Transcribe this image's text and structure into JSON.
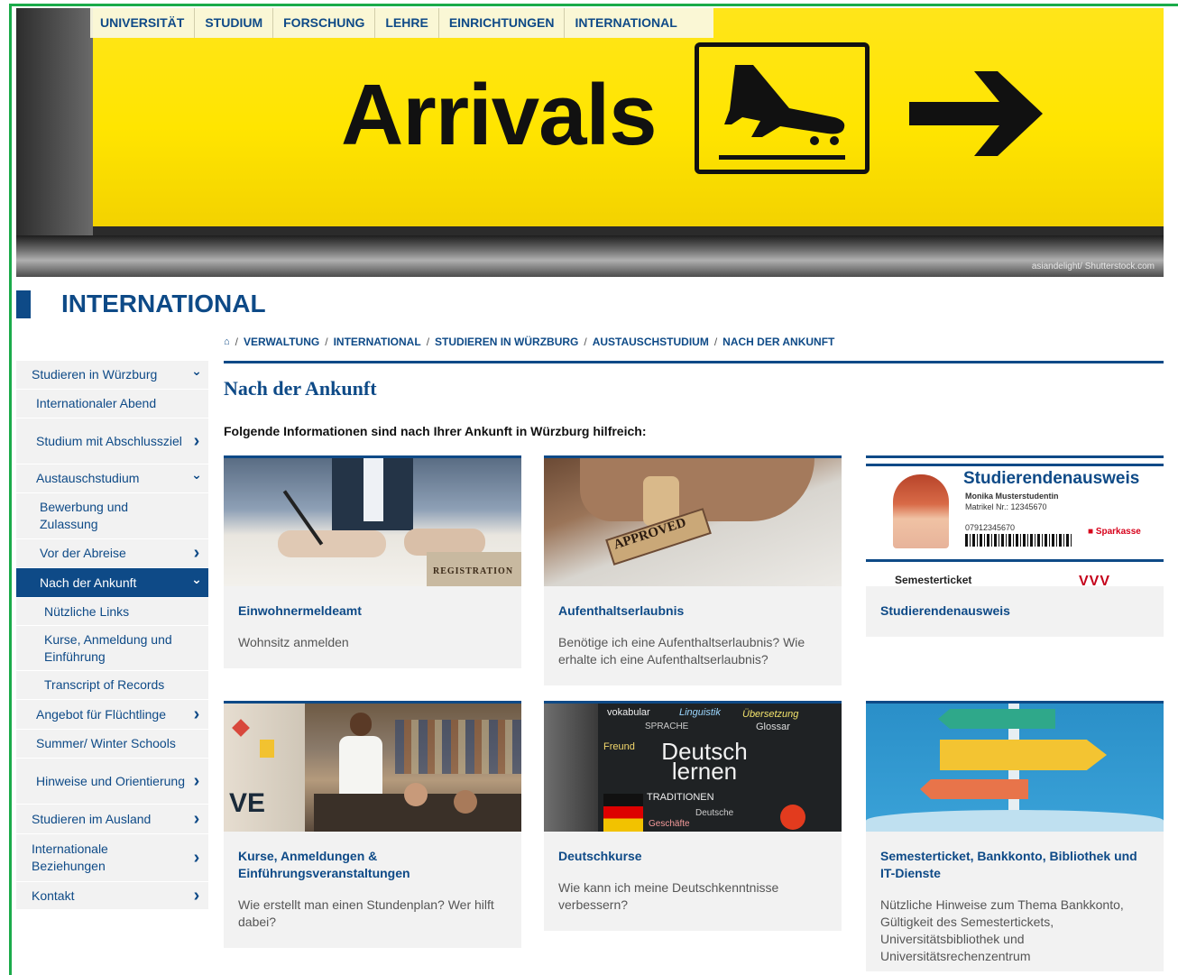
{
  "topnav": [
    "UNIVERSITÄT",
    "STUDIUM",
    "FORSCHUNG",
    "LEHRE",
    "EINRICHTUNGEN",
    "INTERNATIONAL"
  ],
  "hero": {
    "sign_text": "Arrivals",
    "credit": "asiandelight/ Shutterstock.com"
  },
  "section_title": "INTERNATIONAL",
  "breadcrumb": [
    "VERWALTUNG",
    "INTERNATIONAL",
    "STUDIEREN IN WÜRZBURG",
    "AUSTAUSCHSTUDIUM",
    "NACH DER ANKUNFT"
  ],
  "sidebar": [
    {
      "label": "Studieren in Würzburg",
      "level": 0,
      "chevron": "down"
    },
    {
      "label": "Internationaler Abend",
      "level": 1,
      "chevron": ""
    },
    {
      "label": "Studium mit Abschlussziel",
      "level": 1,
      "chevron": "right"
    },
    {
      "label": "Austauschstudium",
      "level": 1,
      "chevron": "down"
    },
    {
      "label": "Bewerbung und Zulassung",
      "level": 2,
      "chevron": ""
    },
    {
      "label": "Vor der Abreise",
      "level": 2,
      "chevron": "right"
    },
    {
      "label": "Nach der Ankunft",
      "level": 2,
      "chevron": "down",
      "active": true
    },
    {
      "label": "Nützliche Links",
      "level": 3,
      "chevron": ""
    },
    {
      "label": "Kurse, Anmeldung und Einführung",
      "level": 3,
      "chevron": ""
    },
    {
      "label": "Transcript of Records",
      "level": 3,
      "chevron": ""
    },
    {
      "label": "Angebot für Flüchtlinge",
      "level": 1,
      "chevron": "right"
    },
    {
      "label": "Summer/ Winter Schools",
      "level": 1,
      "chevron": ""
    },
    {
      "label": "Hinweise und Orientierung",
      "level": 1,
      "chevron": "right"
    },
    {
      "label": "Studieren im Ausland",
      "level": 0,
      "chevron": "right"
    },
    {
      "label": "Internationale Beziehungen",
      "level": 0,
      "chevron": "right"
    },
    {
      "label": "Kontakt",
      "level": 0,
      "chevron": "right"
    }
  ],
  "page_heading": "Nach der Ankunft",
  "intro": "Folgende Informationen sind nach Ihrer Ankunft in Würzburg hilfreich:",
  "cards": [
    {
      "title": "Einwohnermeldeamt",
      "desc": "Wohnsitz anmelden",
      "img_label": "REGISTRATION"
    },
    {
      "title": "Aufenthaltserlaubnis",
      "desc": "Benötige ich eine Aufenthaltserlaubnis? Wie erhalte ich eine Aufenthaltserlaubnis?",
      "img_label": "APPROVED"
    },
    {
      "title": "Studierendenausweis",
      "desc": "",
      "img_label": "Studierendenausweis",
      "id_name": "Monika Musterstudentin",
      "id_matrikel": "Matrikel Nr.: 12345670",
      "id_number": "07912345670",
      "id_bank": "Sparkasse",
      "id_ticket": "Semesterticket"
    },
    {
      "title": "Kurse, Anmeldungen & Einführungsveranstaltungen",
      "desc": "Wie erstellt man einen Stundenplan? Wer hilft dabei?",
      "img_label": "VE"
    },
    {
      "title": "Deutschkurse",
      "desc": "Wie kann ich meine Deutschkenntnisse verbessern?",
      "img_label": "Deutsch lernen"
    },
    {
      "title": "Semesterticket, Bankkonto, Bibliothek und IT-Dienste",
      "desc": "Nützliche Hinweise zum Thema Bankkonto, Gültigkeit des Semestertickets, Universitätsbibliothek und Universitätsrechenzentrum",
      "img_label": ""
    }
  ]
}
